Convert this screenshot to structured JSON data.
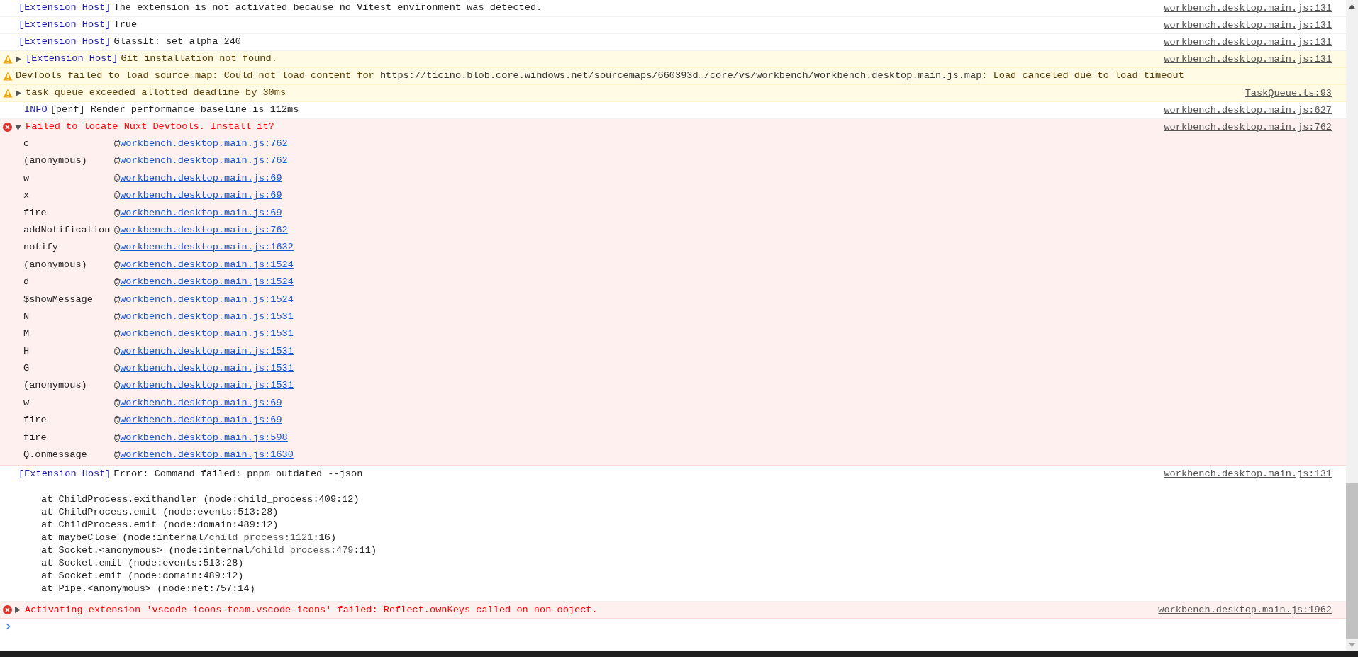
{
  "messages": [
    {
      "kind": "log",
      "prefix": "[Extension Host]",
      "text": "The extension is not activated because no Vitest environment was detected.",
      "source": "workbench.desktop.main.js:131"
    },
    {
      "kind": "log",
      "prefix": "[Extension Host]",
      "text": "True",
      "source": "workbench.desktop.main.js:131"
    },
    {
      "kind": "log",
      "prefix": "[Extension Host]",
      "text": "GlassIt: set alpha 240",
      "source": "workbench.desktop.main.js:131"
    },
    {
      "kind": "warning",
      "expanded": false,
      "prefix": "[Extension Host]",
      "text": "Git installation not found.",
      "source": "workbench.desktop.main.js:131"
    },
    {
      "kind": "warning",
      "text": "DevTools failed to load source map: Could not load content for ",
      "link": "https://ticino.blob.core.windows.net/sourcemaps/660393d…/core/vs/workbench/workbench.desktop.main.js.map",
      "after": ": Load canceled due to load timeout"
    },
    {
      "kind": "warning",
      "expanded": false,
      "text": "task queue exceeded allotted deadline by 30ms",
      "source": "TaskQueue.ts:93"
    },
    {
      "kind": "info",
      "prefix": "INFO",
      "text": "[perf] Render performance baseline is 112ms",
      "source": "workbench.desktop.main.js:627"
    },
    {
      "kind": "error",
      "expanded": true,
      "text": "Failed to locate Nuxt Devtools. Install it?",
      "source": "workbench.desktop.main.js:762",
      "frames": [
        {
          "fn": "c",
          "at": "@",
          "source": "workbench.desktop.main.js:762"
        },
        {
          "fn": "(anonymous)",
          "at": "@",
          "source": "workbench.desktop.main.js:762"
        },
        {
          "fn": "w",
          "at": "@",
          "source": "workbench.desktop.main.js:69"
        },
        {
          "fn": "x",
          "at": "@",
          "source": "workbench.desktop.main.js:69"
        },
        {
          "fn": "fire",
          "at": "@",
          "source": "workbench.desktop.main.js:69"
        },
        {
          "fn": "addNotification",
          "at": "@",
          "source": "workbench.desktop.main.js:762"
        },
        {
          "fn": "notify",
          "at": "@",
          "source": "workbench.desktop.main.js:1632"
        },
        {
          "fn": "(anonymous)",
          "at": "@",
          "source": "workbench.desktop.main.js:1524"
        },
        {
          "fn": "d",
          "at": "@",
          "source": "workbench.desktop.main.js:1524"
        },
        {
          "fn": "$showMessage",
          "at": "@",
          "source": "workbench.desktop.main.js:1524"
        },
        {
          "fn": "N",
          "at": "@",
          "source": "workbench.desktop.main.js:1531"
        },
        {
          "fn": "M",
          "at": "@",
          "source": "workbench.desktop.main.js:1531"
        },
        {
          "fn": "H",
          "at": "@",
          "source": "workbench.desktop.main.js:1531"
        },
        {
          "fn": "G",
          "at": "@",
          "source": "workbench.desktop.main.js:1531"
        },
        {
          "fn": "(anonymous)",
          "at": "@",
          "source": "workbench.desktop.main.js:1531"
        },
        {
          "fn": "w",
          "at": "@",
          "source": "workbench.desktop.main.js:69"
        },
        {
          "fn": "fire",
          "at": "@",
          "source": "workbench.desktop.main.js:69"
        },
        {
          "fn": "fire",
          "at": "@",
          "source": "workbench.desktop.main.js:598"
        },
        {
          "fn": "Q.onmessage",
          "at": "@",
          "source": "workbench.desktop.main.js:1630"
        }
      ]
    },
    {
      "kind": "log",
      "prefix": "[Extension Host]",
      "text": "Error: Command failed: pnpm outdated --json",
      "source": "workbench.desktop.main.js:131",
      "trace": [
        {
          "text": "at ChildProcess.exithandler (node:child_process:409:12)"
        },
        {
          "text": "at ChildProcess.emit (node:events:513:28)"
        },
        {
          "text": "at ChildProcess.emit (node:domain:489:12)"
        },
        {
          "text": "at maybeClose (node:internal",
          "link": "/child_process:1121",
          "after": ":16)"
        },
        {
          "text": "at Socket.<anonymous> (node:internal",
          "link": "/child_process:479",
          "after": ":11)"
        },
        {
          "text": "at Socket.emit (node:events:513:28)"
        },
        {
          "text": "at Socket.emit (node:domain:489:12)"
        },
        {
          "text": "at Pipe.<anonymous> (node:net:757:14)"
        }
      ]
    },
    {
      "kind": "error",
      "expanded": false,
      "text": "Activating extension 'vscode-icons-team.vscode-icons' failed: Reflect.ownKeys called on non-object.",
      "source": "workbench.desktop.main.js:1962"
    }
  ]
}
